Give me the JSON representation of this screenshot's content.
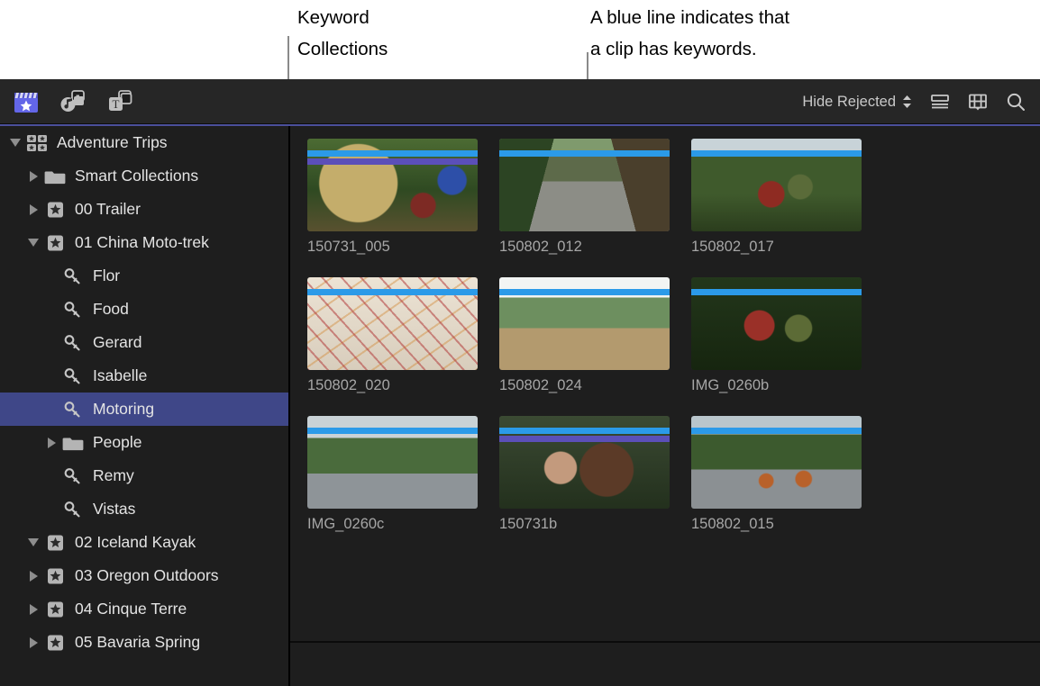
{
  "annotations": [
    {
      "id": "keyword-collections",
      "text": "Keyword\nCollections"
    },
    {
      "id": "blue-line",
      "text": "A blue line indicates that\na clip has keywords."
    }
  ],
  "toolbar": {
    "left_icons": [
      {
        "name": "libraries-icon",
        "label": "Libraries"
      },
      {
        "name": "photos-audio-icon",
        "label": "Photos and Audio"
      },
      {
        "name": "titles-generators-icon",
        "label": "Titles and Generators"
      }
    ],
    "filter": {
      "label": "Hide Rejected"
    },
    "right_icons": [
      {
        "name": "list-view-icon",
        "label": "List View"
      },
      {
        "name": "filmstrip-view-icon",
        "label": "Filmstrip View"
      },
      {
        "name": "search-icon",
        "label": "Search"
      }
    ]
  },
  "sidebar": {
    "items": [
      {
        "label": "Adventure Trips",
        "icon": "library-icon",
        "disclosure": "down",
        "indent": 0,
        "selected": false
      },
      {
        "label": "Smart Collections",
        "icon": "folder-icon",
        "disclosure": "right",
        "indent": 1,
        "selected": false
      },
      {
        "label": "00 Trailer",
        "icon": "event-icon",
        "disclosure": "right",
        "indent": 1,
        "selected": false
      },
      {
        "label": "01 China Moto-trek",
        "icon": "event-icon",
        "disclosure": "down",
        "indent": 1,
        "selected": false
      },
      {
        "label": "Flor",
        "icon": "keyword-icon",
        "disclosure": "none",
        "indent": 2,
        "selected": false
      },
      {
        "label": "Food",
        "icon": "keyword-icon",
        "disclosure": "none",
        "indent": 2,
        "selected": false
      },
      {
        "label": "Gerard",
        "icon": "keyword-icon",
        "disclosure": "none",
        "indent": 2,
        "selected": false
      },
      {
        "label": "Isabelle",
        "icon": "keyword-icon",
        "disclosure": "none",
        "indent": 2,
        "selected": false
      },
      {
        "label": "Motoring",
        "icon": "keyword-icon",
        "disclosure": "none",
        "indent": 2,
        "selected": true
      },
      {
        "label": "People",
        "icon": "folder-icon",
        "disclosure": "right",
        "indent": 2,
        "selected": false
      },
      {
        "label": "Remy",
        "icon": "keyword-icon",
        "disclosure": "none",
        "indent": 2,
        "selected": false
      },
      {
        "label": "Vistas",
        "icon": "keyword-icon",
        "disclosure": "none",
        "indent": 2,
        "selected": false
      },
      {
        "label": "02 Iceland Kayak",
        "icon": "event-icon",
        "disclosure": "down",
        "indent": 1,
        "selected": false
      },
      {
        "label": "03 Oregon Outdoors",
        "icon": "event-icon",
        "disclosure": "right",
        "indent": 1,
        "selected": false
      },
      {
        "label": "04 Cinque Terre",
        "icon": "event-icon",
        "disclosure": "right",
        "indent": 1,
        "selected": false
      },
      {
        "label": "05 Bavaria Spring",
        "icon": "event-icon",
        "disclosure": "right",
        "indent": 1,
        "selected": false
      }
    ]
  },
  "browser": {
    "clips": [
      {
        "name": "150731_005",
        "keyword_line": true,
        "favorite_line": true,
        "art": "motorcyclists-helmet-closeup"
      },
      {
        "name": "150802_012",
        "keyword_line": true,
        "favorite_line": false,
        "art": "jungle-road-riders"
      },
      {
        "name": "150802_017",
        "keyword_line": true,
        "favorite_line": false,
        "art": "two-riders-red-bike"
      },
      {
        "name": "150802_020",
        "keyword_line": true,
        "favorite_line": false,
        "art": "paper-map-closeup"
      },
      {
        "name": "150802_024",
        "keyword_line": true,
        "favorite_line": false,
        "art": "hill-trail-valley"
      },
      {
        "name": "IMG_0260b",
        "keyword_line": true,
        "favorite_line": false,
        "art": "rider-pointing-forest"
      },
      {
        "name": "IMG_0260c",
        "keyword_line": true,
        "favorite_line": false,
        "art": "wet-road-single-rider"
      },
      {
        "name": "150731b",
        "keyword_line": true,
        "favorite_line": true,
        "art": "friends-in-car"
      },
      {
        "name": "150802_015",
        "keyword_line": true,
        "favorite_line": false,
        "art": "two-bikes-mountain-road"
      }
    ]
  },
  "colors": {
    "keyword_line": "#2b9ae8",
    "favorite_line": "#5b4fb8",
    "selection": "#3f4788",
    "toolbar_accent": "#4b4f9b",
    "window_background": "#1e1e1e",
    "toolbar_background": "#262626"
  }
}
